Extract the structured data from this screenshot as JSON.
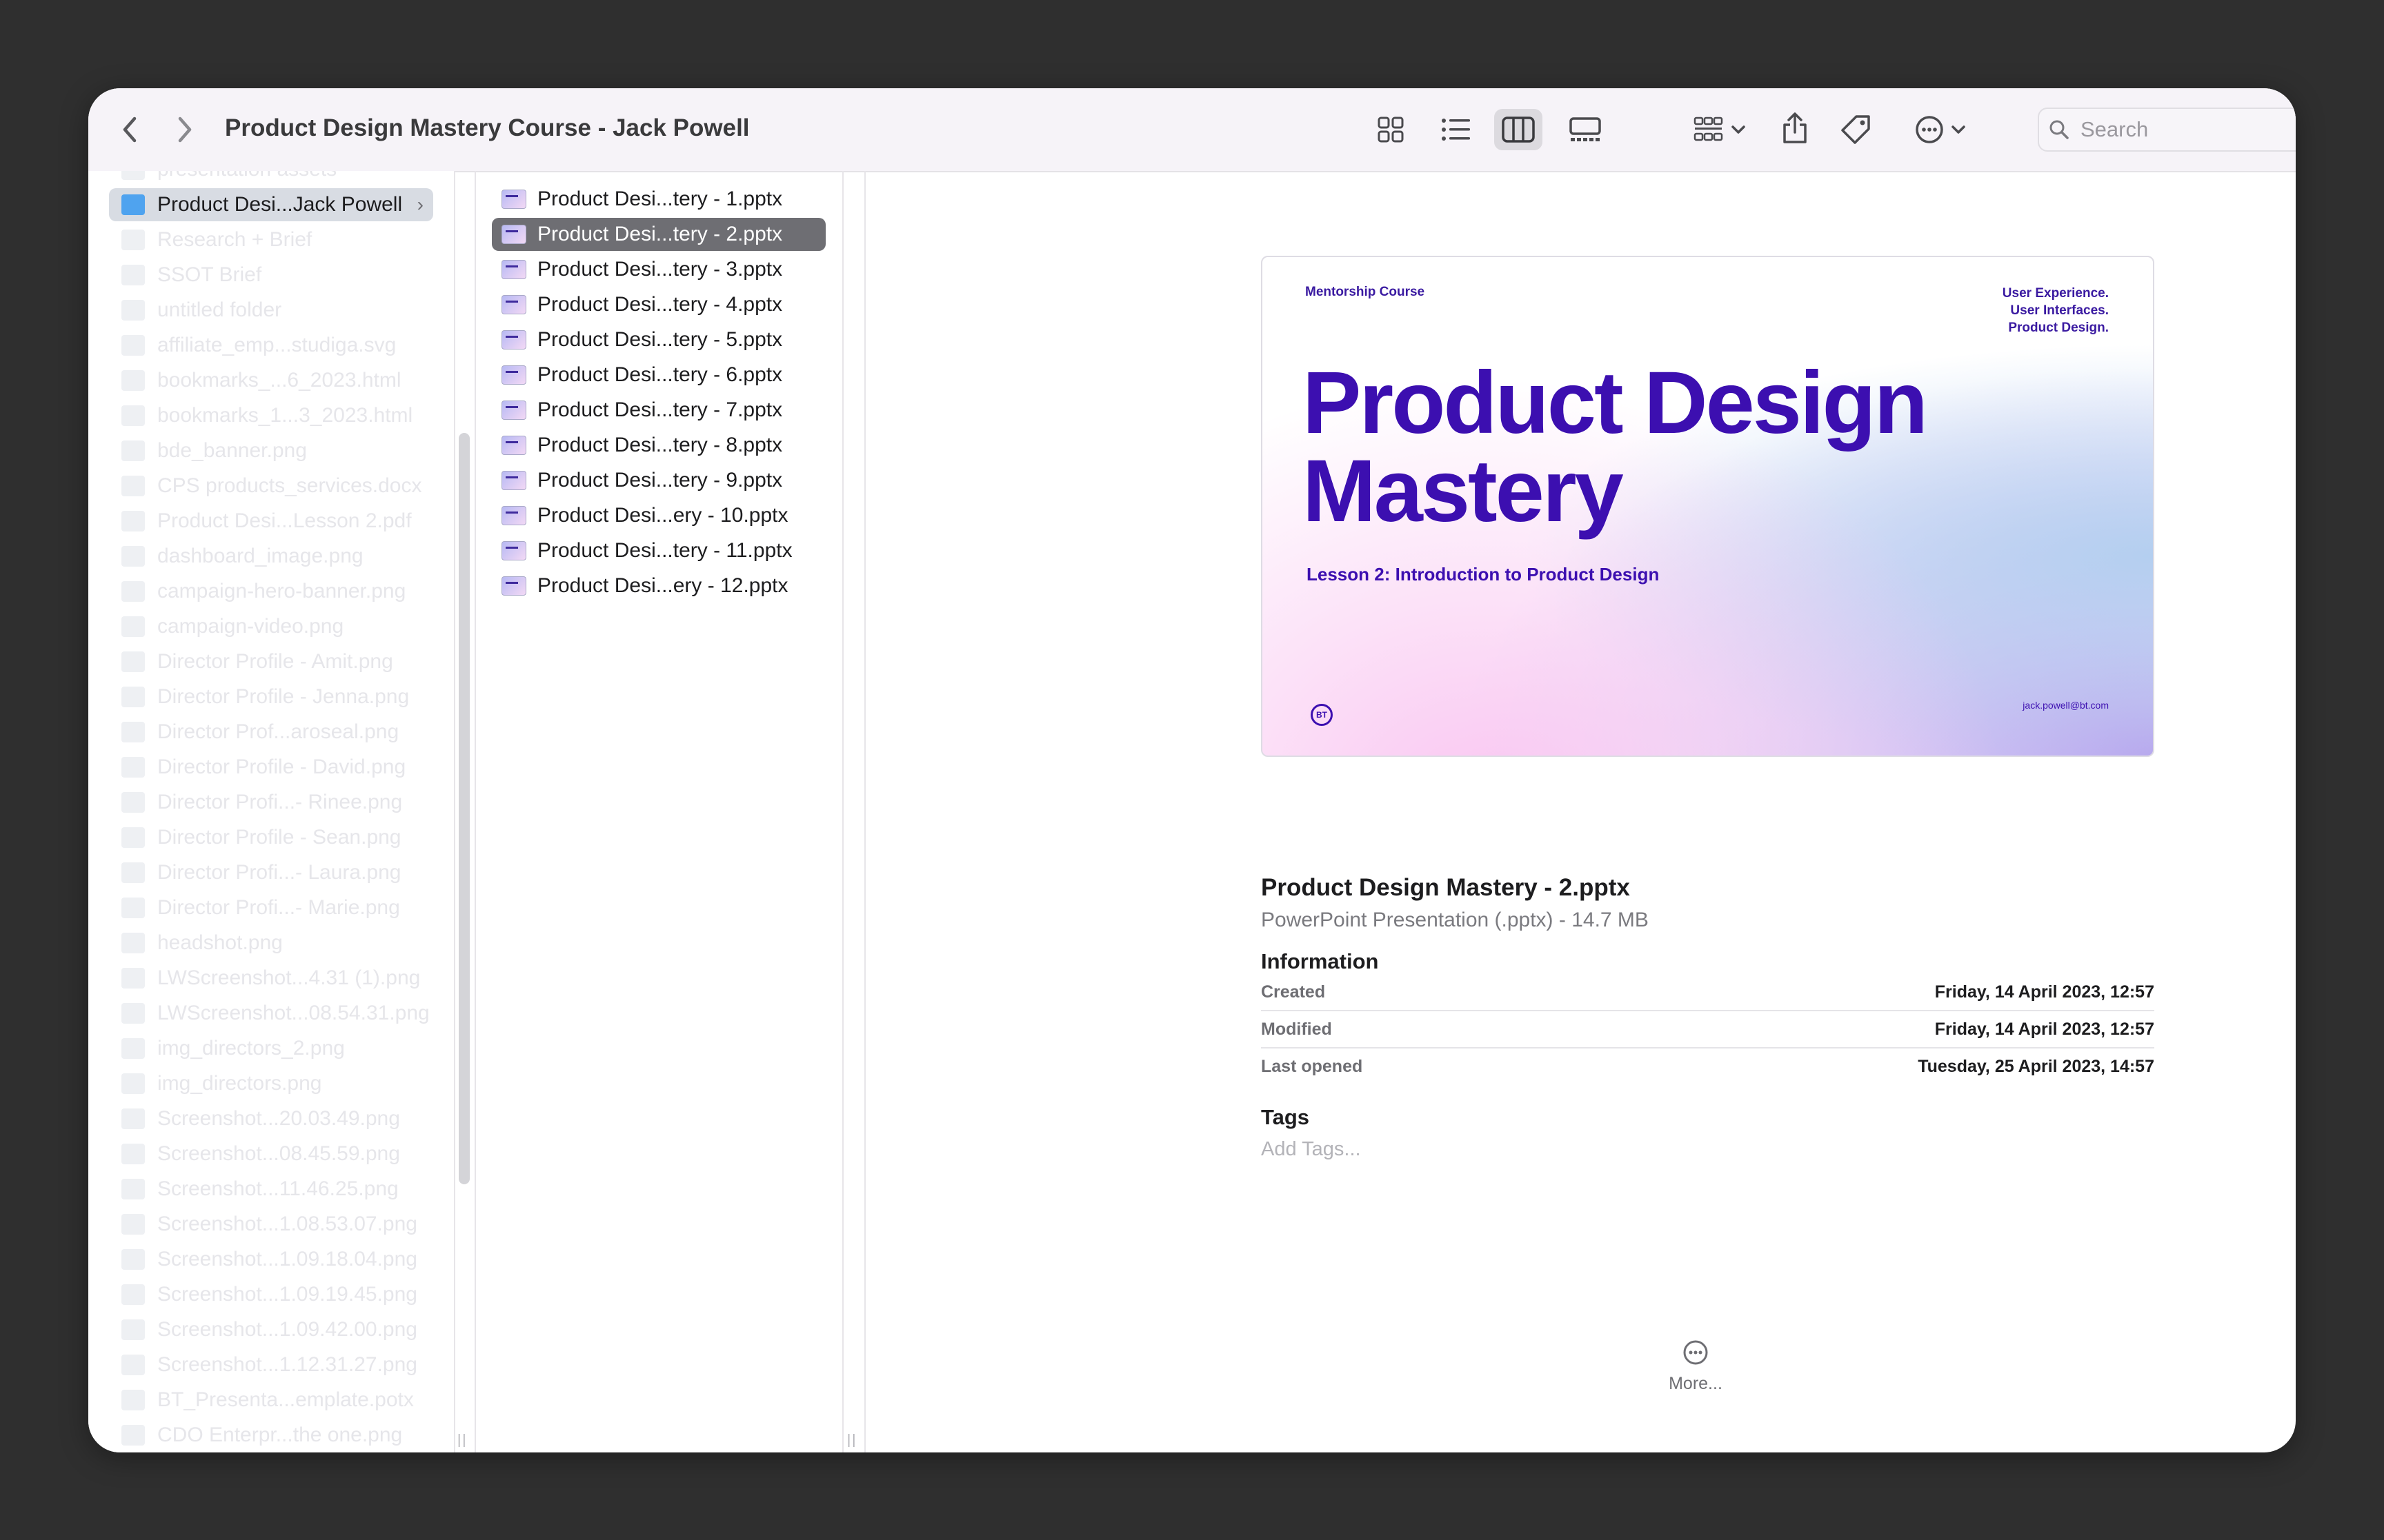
{
  "window": {
    "title": "Product Design Mastery Course - Jack Powell"
  },
  "toolbar": {
    "search_placeholder": "Search",
    "view_icons": [
      "grid-view-icon",
      "list-view-icon",
      "column-view-icon",
      "gallery-view-icon"
    ],
    "active_view": "column-view"
  },
  "sidebar": {
    "items": [
      "presentation assets",
      "Product Desi...Jack Powell",
      "Research + Brief",
      "SSOT Brief",
      "untitled folder",
      "affiliate_emp...studiga.svg",
      "bookmarks_...6_2023.html",
      "bookmarks_1...3_2023.html",
      "bde_banner.png",
      "CPS products_services.docx",
      "Product Desi...Lesson 2.pdf",
      "dashboard_image.png",
      "campaign-hero-banner.png",
      "campaign-video.png",
      "Director Profile - Amit.png",
      "Director Profile - Jenna.png",
      "Director Prof...aroseal.png",
      "Director Profile - David.png",
      "Director Profi...- Rinee.png",
      "Director Profile - Sean.png",
      "Director Profi...- Laura.png",
      "Director Profi...- Marie.png",
      "headshot.png",
      "LWScreenshot...4.31 (1).png",
      "LWScreenshot...08.54.31.png",
      "img_directors_2.png",
      "img_directors.png",
      "Screenshot...20.03.49.png",
      "Screenshot...08.45.59.png",
      "Screenshot...11.46.25.png",
      "Screenshot...1.08.53.07.png",
      "Screenshot...1.09.18.04.png",
      "Screenshot...1.09.19.45.png",
      "Screenshot...1.09.42.00.png",
      "Screenshot...1.12.31.27.png",
      "BT_Presenta...emplate.potx",
      "CDO Enterpr...the one.png"
    ]
  },
  "files": {
    "items": [
      "Product Desi...tery - 1.pptx",
      "Product Desi...tery - 2.pptx",
      "Product Desi...tery - 3.pptx",
      "Product Desi...tery - 4.pptx",
      "Product Desi...tery - 5.pptx",
      "Product Desi...tery - 6.pptx",
      "Product Desi...tery - 7.pptx",
      "Product Desi...tery - 8.pptx",
      "Product Desi...tery - 9.pptx",
      "Product Desi...ery - 10.pptx",
      "Product Desi...tery - 11.pptx",
      "Product Desi...ery - 12.pptx"
    ],
    "selected_index": 1
  },
  "preview": {
    "course": "Mentorship Course",
    "tagline_1": "User Experience.",
    "tagline_2": "User Interfaces.",
    "tagline_3": "Product Design.",
    "title_line_1": "Product Design",
    "title_line_2": "Mastery",
    "lesson": "Lesson 2: Introduction to Product Design",
    "logo": "BT",
    "email": "jack.powell@bt.com",
    "accent_color": "#3c0fb0"
  },
  "info": {
    "name": "Product Design Mastery - 2.pptx",
    "kind": "PowerPoint Presentation (.pptx) - 14.7 MB",
    "header": "Information",
    "rows": [
      {
        "label": "Created",
        "value": "Friday, 14 April 2023, 12:57"
      },
      {
        "label": "Modified",
        "value": "Friday, 14 April 2023, 12:57"
      },
      {
        "label": "Last opened",
        "value": "Tuesday, 25 April 2023, 14:57"
      }
    ],
    "tags_header": "Tags",
    "tags_placeholder": "Add Tags..."
  },
  "more": {
    "label": "More..."
  }
}
